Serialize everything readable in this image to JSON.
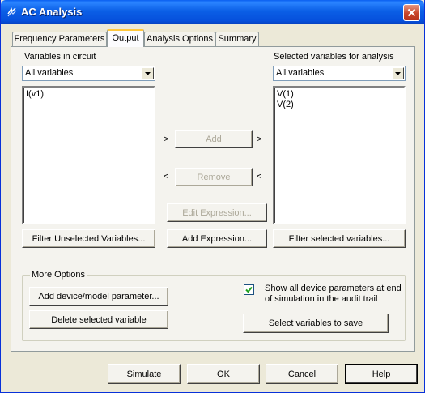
{
  "window": {
    "title": "AC Analysis"
  },
  "tabs": [
    {
      "label": "Frequency Parameters"
    },
    {
      "label": "Output"
    },
    {
      "label": "Analysis Options"
    },
    {
      "label": "Summary"
    }
  ],
  "left_panel": {
    "heading": "Variables in circuit",
    "filter_select": "All variables",
    "items": [
      "I(v1)"
    ],
    "filter_button": "Filter Unselected Variables..."
  },
  "right_panel": {
    "heading": "Selected variables for analysis",
    "filter_select": "All variables",
    "items": [
      "V(1)",
      "V(2)"
    ],
    "filter_button": "Filter selected variables..."
  },
  "middle": {
    "add_button": "Add",
    "remove_button": "Remove",
    "edit_expression_button": "Edit Expression...",
    "add_expression_button": "Add Expression...",
    "chevron_right": ">",
    "chevron_left": "<"
  },
  "more_options": {
    "title": "More Options",
    "add_param_button": "Add device/model parameter...",
    "delete_var_button": "Delete selected variable",
    "show_params_checkbox": {
      "checked": true,
      "line1": "Show all device parameters at end",
      "line2": "of simulation in the audit trail"
    },
    "select_vars_button": "Select variables to save"
  },
  "footer": {
    "simulate": "Simulate",
    "ok": "OK",
    "cancel": "Cancel",
    "help": "Help"
  }
}
